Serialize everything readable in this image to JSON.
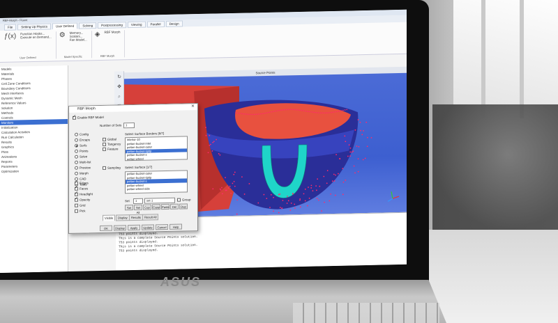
{
  "app": {
    "title": "RBF-Morph - Fluent",
    "ribbon_tabs": [
      "File",
      "Setting Up Physics",
      "User Defined",
      "Solving",
      "Postprocessing",
      "Viewing",
      "Parallel",
      "Design"
    ],
    "active_tab": "User Defined",
    "ribbon_groups": [
      {
        "label": "User Defined",
        "items": [
          "Function Hooks...",
          "Execute on Demand..."
        ],
        "icon": "function-icon"
      },
      {
        "label": "Model Specific",
        "items": [
          "Memory...",
          "Scalars...",
          "Fan Model..."
        ],
        "icon": "model-icon"
      },
      {
        "label": "RBF Morph",
        "items": [
          "RBF Morph"
        ],
        "icon": "rbf-icon"
      }
    ]
  },
  "tree": {
    "items": [
      "Models",
      "Materials",
      "Phases",
      "Cell Zone Conditions",
      "Boundary Conditions",
      "Mesh Interfaces",
      "Dynamic Mesh",
      "Reference Values",
      "Solution",
      "Methods",
      "Controls",
      "Monitors",
      "Initialization",
      "Calculation Activities",
      "Run Calculation",
      "Results",
      "Graphics",
      "Plots",
      "Animations",
      "Reports",
      "Parameters",
      "Optimization"
    ],
    "selected_index": 11
  },
  "viewport": {
    "title": "Source Points",
    "axis_labels": [
      "X",
      "Y",
      "Z"
    ],
    "colors": {
      "background": "#3f60d2",
      "shell": "#2b2f9a",
      "surface": "#e0453c",
      "cavity": "#1fd5c9",
      "points": "#ff2a6d"
    }
  },
  "dialog": {
    "title": "RBF-Morph",
    "enable_label": "Enable RBF Model",
    "number_of_sets_label": "Number of Sets",
    "number_of_sets_value": "1",
    "modes": [
      "Config",
      "Encaps",
      "Surfs",
      "Points",
      "Solve",
      "Multi-list",
      "Preview",
      "Morph",
      "CAD",
      "Tools"
    ],
    "mode_selected": "Surfs",
    "options": [
      "Global",
      "Tangency",
      "Feature"
    ],
    "border_list_title": "Select Surface Borders",
    "border_list_count": "[8/7]",
    "border_items": [
      "interior-10",
      "pelton-bucket-inlet",
      "pelton-bucket-outer",
      "pelton-bucket-tiptip",
      "pelton-bucket-s",
      "pelton-wheel"
    ],
    "border_selected": 3,
    "sampling_label": "Sampling",
    "surface_list_title": "Select Surface",
    "surface_list_count": "[1/7]",
    "surface_items": [
      "pelton-bucket-outer",
      "pelton-bucket-tiptip",
      "pelton-bucket-s",
      "pelton-wheel",
      "pelton-wheel-side"
    ],
    "surface_selected": 2,
    "checks": [
      {
        "label": "Edges",
        "on": true
      },
      {
        "label": "Faces",
        "on": true
      },
      {
        "label": "Headlight",
        "on": true
      },
      {
        "label": "Opacity",
        "on": true
      },
      {
        "label": "Grid",
        "on": false
      },
      {
        "label": "Pick",
        "on": false
      }
    ],
    "set_label": "Set",
    "set_value": "set-1",
    "group_label": "Group",
    "set_buttons": [
      "Set",
      "Set All",
      "Cop",
      "Copy",
      "Paste",
      "Del",
      "Dup"
    ],
    "bottom_tabs": [
      "Visible",
      "Display",
      "Results",
      "Result All"
    ],
    "bottom_tab_active": "Visible",
    "footer_buttons": [
      "OK",
      "Display",
      "Apply",
      "Update",
      "Cancel",
      "Help"
    ]
  },
  "console": {
    "lines": [
      "  Volume = 1.47960e-05",
      "  Particles = 1",
      "This is a complete Source Points solution.",
      "753 points displayed.",
      "This is a complete Source Points solution.",
      "753 points displayed.",
      "This is a complete Source Points solution.",
      "753 points displayed."
    ]
  },
  "laptop": {
    "brand": "ASUS"
  }
}
